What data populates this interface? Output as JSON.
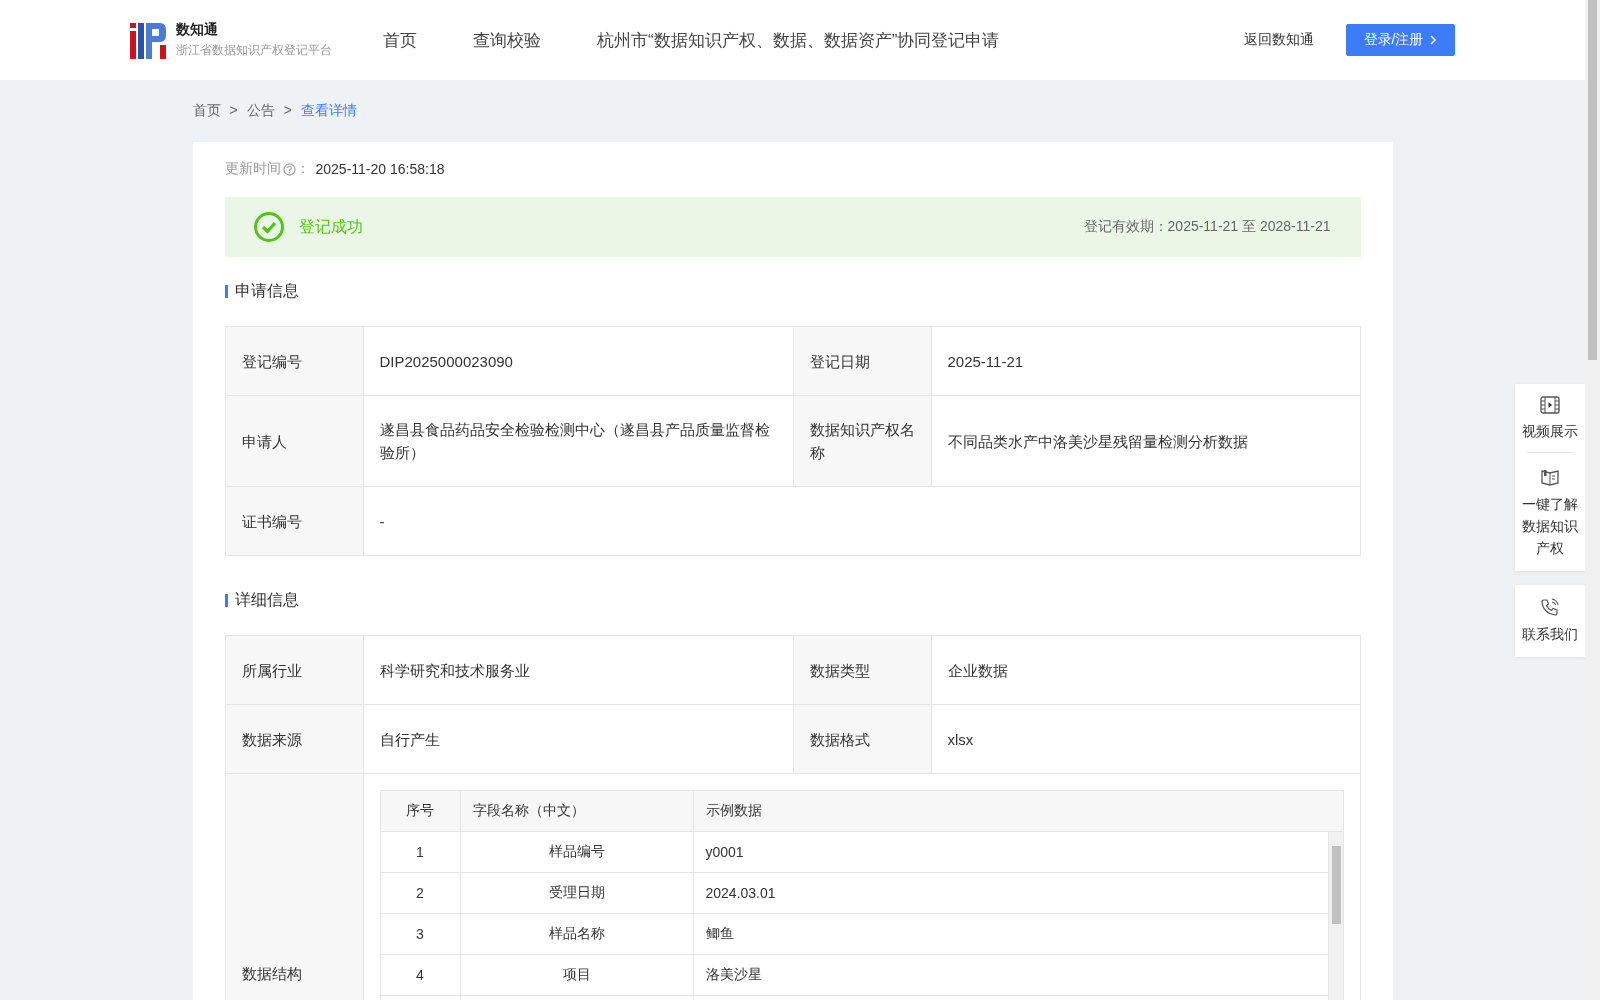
{
  "header": {
    "logo": {
      "title": "数知通",
      "subtitle": "浙江省数据知识产权登记平台"
    },
    "nav": [
      "首页",
      "查询校验",
      "杭州市“数据知识产权、数据、数据资产”协同登记申请"
    ],
    "back_link": "返回数知通",
    "login_button": "登录/注册"
  },
  "breadcrumb": {
    "separator": ">",
    "items": [
      "首页",
      "公告",
      "查看详情"
    ]
  },
  "updated": {
    "label": "更新时间",
    "colon": "：",
    "value": "2025-11-20 16:58:18"
  },
  "status": {
    "text": "登记成功",
    "validity": "登记有效期：2025-11-21 至 2028-11-21"
  },
  "sections": [
    {
      "title": "申请信息",
      "rows": [
        {
          "kind": "pair",
          "cells": [
            {
              "label": "登记编号",
              "value": "DIP2025000023090"
            },
            {
              "label": "登记日期",
              "value": "2025-11-21"
            }
          ]
        },
        {
          "kind": "pair",
          "cells": [
            {
              "label": "申请人",
              "value": "遂昌县食品药品安全检验检测中心（遂昌县产品质量监督检验所）"
            },
            {
              "label": "数据知识产权名称",
              "value": "不同品类水产中洛美沙星残留量检测分析数据"
            }
          ]
        },
        {
          "kind": "single",
          "cells": [
            {
              "label": "证书编号",
              "value": "-"
            }
          ]
        }
      ]
    },
    {
      "title": "详细信息",
      "rows": [
        {
          "kind": "pair",
          "cells": [
            {
              "label": "所属行业",
              "value": "科学研究和技术服务业"
            },
            {
              "label": "数据类型",
              "value": "企业数据"
            }
          ]
        },
        {
          "kind": "pair",
          "cells": [
            {
              "label": "数据来源",
              "value": "自行产生"
            },
            {
              "label": "数据格式",
              "value": "xlsx"
            }
          ]
        },
        {
          "kind": "table",
          "label": "数据结构",
          "table": {
            "columns": [
              "序号",
              "字段名称（中文）",
              "示例数据"
            ],
            "rows": [
              [
                "1",
                "样品编号",
                "y0001"
              ],
              [
                "2",
                "受理日期",
                "2024.03.01"
              ],
              [
                "3",
                "样品名称",
                "鲫鱼"
              ],
              [
                "4",
                "项目",
                "洛美沙星"
              ]
            ]
          }
        }
      ]
    }
  ],
  "side_panel": {
    "groups": [
      [
        "视频展示",
        "一键了解数据知识产权"
      ],
      [
        "联系我们"
      ]
    ]
  }
}
